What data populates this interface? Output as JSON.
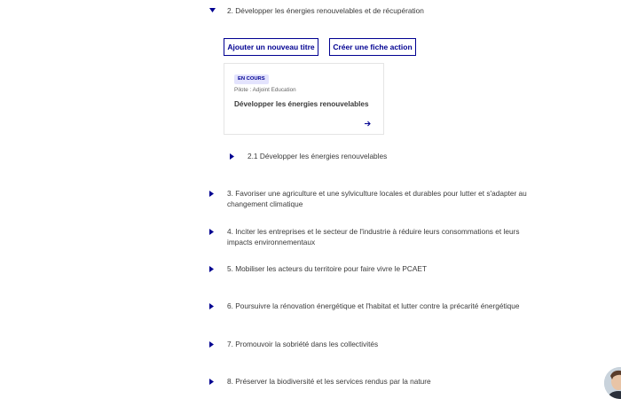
{
  "section2": {
    "label": "2. Développer les énergies renouvelables et de récupération"
  },
  "actions": {
    "add_title_label": "Ajouter un nouveau titre",
    "create_sheet_label": "Créer une fiche action"
  },
  "fiche_card": {
    "status": "EN COURS",
    "pilote": "Pilote : Adjoint Education",
    "title": "Développer les énergies renouvelables"
  },
  "subsection_2_1": {
    "label": "2.1 Développer les énergies renouvelables"
  },
  "sections": [
    {
      "label": "3. Favoriser une agriculture et une sylviculture locales et durables pour lutter et s'adapter au changement climatique"
    },
    {
      "label": "4. Inciter les entreprises et le secteur de l'industrie à réduire leurs consommations et leurs impacts environnementaux"
    },
    {
      "label": "5. Mobiliser les acteurs du territoire pour faire vivre le PCAET"
    },
    {
      "label": "6. Poursuivre la rénovation énergétique et l'habitat et lutter contre la précarité énergétique"
    },
    {
      "label": "7. Promouvoir la sobriété dans les collectivités"
    },
    {
      "label": "8. Préserver la biodiversité et les services rendus par la nature"
    }
  ],
  "icons": {
    "expanded_caret": "caret-down-icon",
    "collapsed_caret": "caret-right-icon",
    "card_arrow": "arrow-right-icon"
  },
  "colors": {
    "accent": "#000091",
    "badge_bg": "#e3e3fd",
    "text": "#3a3a3a",
    "muted": "#666666",
    "border": "#e5e5e5"
  }
}
